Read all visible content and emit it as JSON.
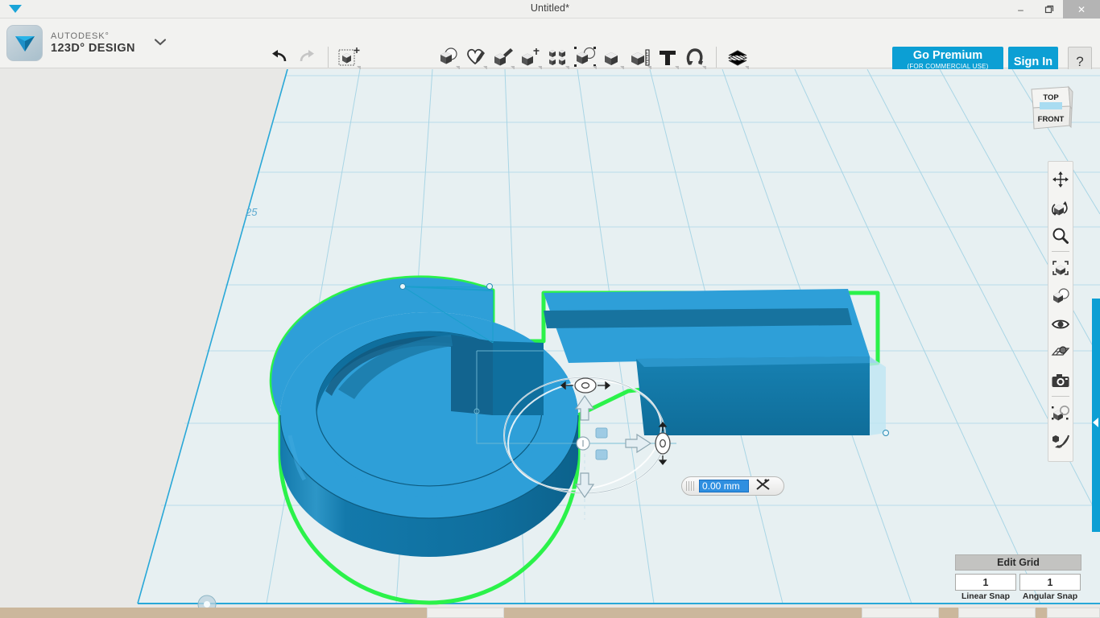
{
  "window": {
    "title": "Untitled*",
    "minimize_label": "–",
    "maximize_label": "❐",
    "close_label": "✕"
  },
  "brand": {
    "line1": "AUTODESK°",
    "line2": "123D° DESIGN",
    "caret": "⌄"
  },
  "toolbar": {
    "history": [
      {
        "name": "undo-icon",
        "label": "Undo",
        "enabled": true
      },
      {
        "name": "redo-icon",
        "label": "Redo",
        "enabled": false
      }
    ],
    "transform_tool": {
      "name": "transform-icon",
      "label": "Transform"
    },
    "tools": [
      {
        "name": "primitives-icon",
        "label": "Primitives"
      },
      {
        "name": "sketch-icon",
        "label": "Sketch"
      },
      {
        "name": "construct-icon",
        "label": "Construct"
      },
      {
        "name": "modify-icon",
        "label": "Modify"
      },
      {
        "name": "pattern-icon",
        "label": "Pattern"
      },
      {
        "name": "grouping-icon",
        "label": "Grouping"
      },
      {
        "name": "combine-icon",
        "label": "Combine"
      },
      {
        "name": "measure-icon",
        "label": "Measure"
      },
      {
        "name": "text-icon",
        "label": "Text"
      },
      {
        "name": "snap-icon",
        "label": "Snap"
      }
    ],
    "materials_tool": {
      "name": "materials-icon",
      "label": "Material"
    },
    "premium": {
      "line1": "Go Premium",
      "line2": "(FOR COMMERCIAL USE)"
    },
    "signin": "Sign In",
    "help": "?"
  },
  "viewcube": {
    "top_label": "TOP",
    "front_label": "FRONT"
  },
  "navbar": {
    "items": [
      {
        "name": "pan-icon",
        "label": "Pan"
      },
      {
        "name": "orbit-icon",
        "label": "Orbit"
      },
      {
        "name": "zoom-icon",
        "label": "Zoom"
      },
      {
        "name": "fit-icon",
        "label": "Fit"
      },
      {
        "name": "view-style-icon",
        "label": "View Style"
      },
      {
        "name": "visibility-icon",
        "label": "Visibility"
      },
      {
        "name": "grid-snap-icon",
        "label": "Grid / Snaps"
      },
      {
        "name": "camera-icon",
        "label": "Camera"
      },
      {
        "name": "materials-browser-icon",
        "label": "Materials"
      },
      {
        "name": "effects-icon",
        "label": "Effects"
      }
    ]
  },
  "grid_panel": {
    "title": "Edit Grid",
    "linear_snap": {
      "value": "1",
      "label": "Linear Snap"
    },
    "angular_snap": {
      "value": "1",
      "label": "Angular Snap"
    }
  },
  "dimension_input": {
    "value": "0.00 mm",
    "placeholder": "0.00 mm",
    "lock_icon": "constrain-icon"
  },
  "scene": {
    "axis_label": "25",
    "selection_outline_color": "#2bf24a",
    "body_top_color": "#2e9fd8",
    "body_side_color": "#1176a8",
    "body_inner_color": "#0f6f9e",
    "grid_line_color": "#9ed4e6",
    "grid_fill_color": "#e7f0f2",
    "background_color": "#e8e8e6",
    "gizmo": {
      "arrow_up": "move-up-arrow",
      "arrow_down": "move-down-arrow",
      "arrow_right": "move-right-arrow",
      "rotate_handle_top": "rotate-handle",
      "rotate_handle_right": "rotate-handle",
      "center_handle": "center-handle",
      "scale_handle_a": "scale-handle",
      "scale_handle_b": "scale-handle"
    }
  }
}
